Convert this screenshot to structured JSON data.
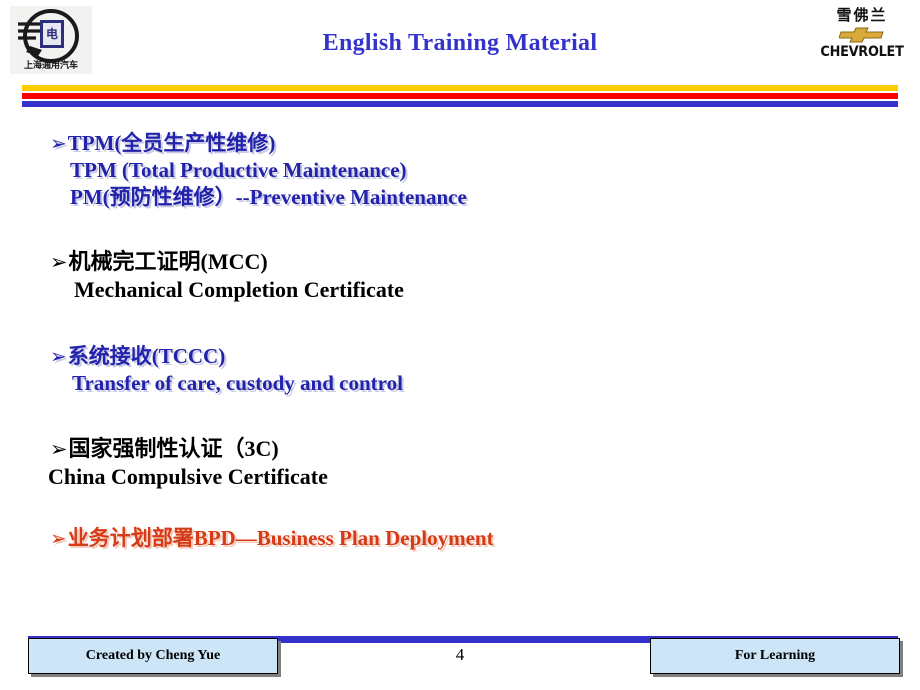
{
  "header": {
    "title": "English Training Material",
    "title_color": "#3333cc",
    "left_logo": {
      "name": "shanghai-gm-logo",
      "caption": "上海通用汽车"
    },
    "right_logo": {
      "name": "chevrolet-logo",
      "chinese_name": "雪佛兰",
      "wordmark": "CHEVROLET"
    }
  },
  "rules": {
    "gold": "#ffcc00",
    "red": "#ff0000",
    "blue": "#3333cc"
  },
  "body": {
    "bullet_glyph": "➢",
    "blocks": [
      {
        "id": "tpm",
        "style": "emboss-blue",
        "color": "#2222aa",
        "lines": [
          "TPM(全员生产性维修)",
          "TPM (Total Productive Maintenance)",
          "PM(预防性维修）--Preventive Maintenance"
        ]
      },
      {
        "id": "mcc",
        "style": "plain-black",
        "color": "#000000",
        "lines": [
          "机械完工证明(MCC)",
          "Mechanical Completion Certificate"
        ]
      },
      {
        "id": "tccc",
        "style": "emboss-blue",
        "color": "#2222aa",
        "lines": [
          "系统接收(TCCC)",
          "Transfer of care, custody and control"
        ]
      },
      {
        "id": "3c",
        "style": "plain-black",
        "color": "#000000",
        "lines": [
          "国家强制性认证（3C)",
          "China Compulsive Certificate"
        ]
      },
      {
        "id": "bpd",
        "style": "emboss-red",
        "color": "#d63a16",
        "lines": [
          "业务计划部署BPD—Business Plan Deployment"
        ]
      }
    ]
  },
  "footer": {
    "bar_color": "#3333cc",
    "left_label": "Created by Cheng Yue",
    "right_label": "For Learning",
    "page_number": "4",
    "box_fill": "#cce6f7"
  }
}
